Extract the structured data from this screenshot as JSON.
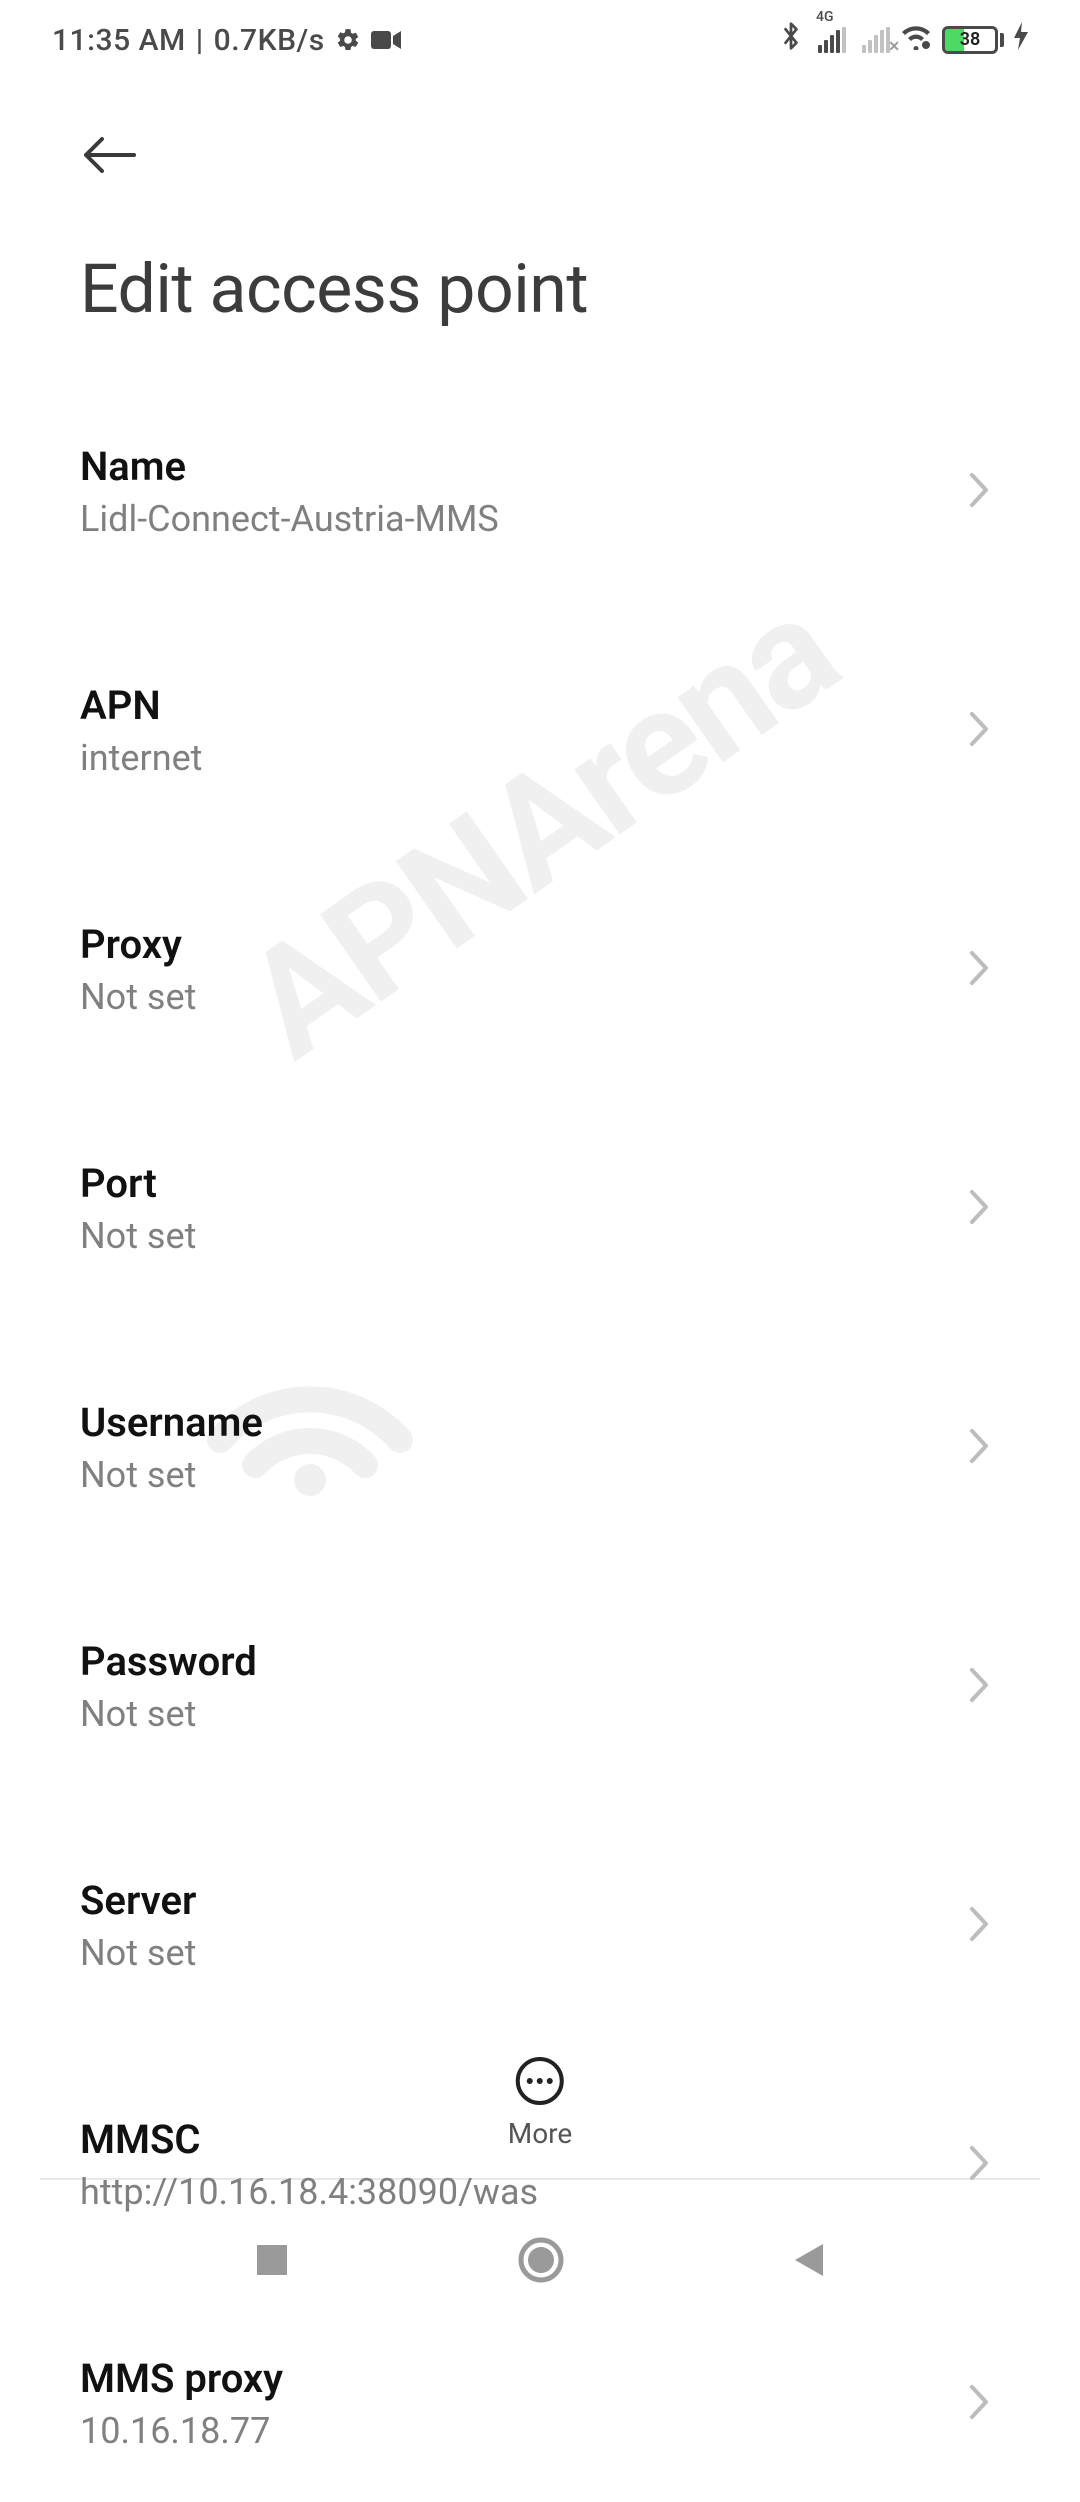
{
  "status_bar": {
    "time": "11:35 AM",
    "net_speed": "0.7KB/s",
    "battery_pct": "38"
  },
  "page": {
    "title": "Edit access point"
  },
  "settings": [
    {
      "label": "Name",
      "value": "Lidl-Connect-Austria-MMS"
    },
    {
      "label": "APN",
      "value": "internet"
    },
    {
      "label": "Proxy",
      "value": "Not set"
    },
    {
      "label": "Port",
      "value": "Not set"
    },
    {
      "label": "Username",
      "value": "Not set"
    },
    {
      "label": "Password",
      "value": "Not set"
    },
    {
      "label": "Server",
      "value": "Not set"
    },
    {
      "label": "MMSC",
      "value": "http://10.16.18.4:38090/was"
    },
    {
      "label": "MMS proxy",
      "value": "10.16.18.77"
    }
  ],
  "more": {
    "label": "More"
  },
  "watermark": "APNArena"
}
